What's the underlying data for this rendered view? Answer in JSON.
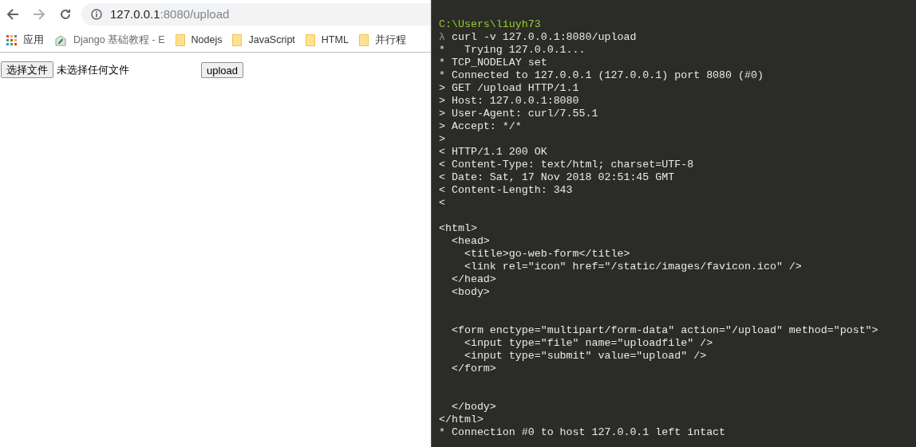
{
  "browser": {
    "nav": {
      "back_disabled": false,
      "forward_disabled": true
    },
    "url": {
      "host": "127.0.0.1",
      "path": ":8080/upload"
    },
    "bookmarks": [
      {
        "kind": "apps",
        "label": "应用"
      },
      {
        "kind": "page",
        "label": "Django 基础教程 - E"
      },
      {
        "kind": "folder",
        "label": "Nodejs"
      },
      {
        "kind": "folder",
        "label": "JavaScript"
      },
      {
        "kind": "folder",
        "label": "HTML"
      },
      {
        "kind": "folder",
        "label": "并行程"
      }
    ],
    "form": {
      "file_button": "选择文件",
      "file_status": "未选择任何文件",
      "submit": "upload"
    }
  },
  "terminal": {
    "lines": [
      {
        "kind": "path",
        "text": "C:\\Users\\liuyh73"
      },
      {
        "kind": "command",
        "prompt": "λ",
        "text": "curl -v 127.0.0.1:8080/upload"
      },
      {
        "kind": "output",
        "text": "*   Trying 127.0.0.1..."
      },
      {
        "kind": "output",
        "text": "* TCP_NODELAY set"
      },
      {
        "kind": "output",
        "text": "* Connected to 127.0.0.1 (127.0.0.1) port 8080 (#0)"
      },
      {
        "kind": "output",
        "text": "> GET /upload HTTP/1.1"
      },
      {
        "kind": "output",
        "text": "> Host: 127.0.0.1:8080"
      },
      {
        "kind": "output",
        "text": "> User-Agent: curl/7.55.1"
      },
      {
        "kind": "output",
        "text": "> Accept: */*"
      },
      {
        "kind": "output",
        "text": ">"
      },
      {
        "kind": "output",
        "text": "< HTTP/1.1 200 OK"
      },
      {
        "kind": "output",
        "text": "< Content-Type: text/html; charset=UTF-8"
      },
      {
        "kind": "output",
        "text": "< Date: Sat, 17 Nov 2018 02:51:45 GMT"
      },
      {
        "kind": "output",
        "text": "< Content-Length: 343"
      },
      {
        "kind": "output",
        "text": "<"
      },
      {
        "kind": "blank"
      },
      {
        "kind": "output",
        "text": "<html>"
      },
      {
        "kind": "output",
        "text": "  <head>"
      },
      {
        "kind": "output",
        "text": "    <title>go-web-form</title>"
      },
      {
        "kind": "output",
        "text": "    <link rel=\"icon\" href=\"/static/images/favicon.ico\" />"
      },
      {
        "kind": "output",
        "text": "  </head>"
      },
      {
        "kind": "output",
        "text": "  <body>"
      },
      {
        "kind": "blank"
      },
      {
        "kind": "blank"
      },
      {
        "kind": "output",
        "text": "  <form enctype=\"multipart/form-data\" action=\"/upload\" method=\"post\">"
      },
      {
        "kind": "output",
        "text": "    <input type=\"file\" name=\"uploadfile\" />"
      },
      {
        "kind": "output",
        "text": "    <input type=\"submit\" value=\"upload\" />"
      },
      {
        "kind": "output",
        "text": "  </form>"
      },
      {
        "kind": "blank"
      },
      {
        "kind": "blank"
      },
      {
        "kind": "output",
        "text": "  </body>"
      },
      {
        "kind": "output",
        "text": "</html>"
      },
      {
        "kind": "output",
        "text": "* Connection #0 to host 127.0.0.1 left intact"
      }
    ]
  }
}
